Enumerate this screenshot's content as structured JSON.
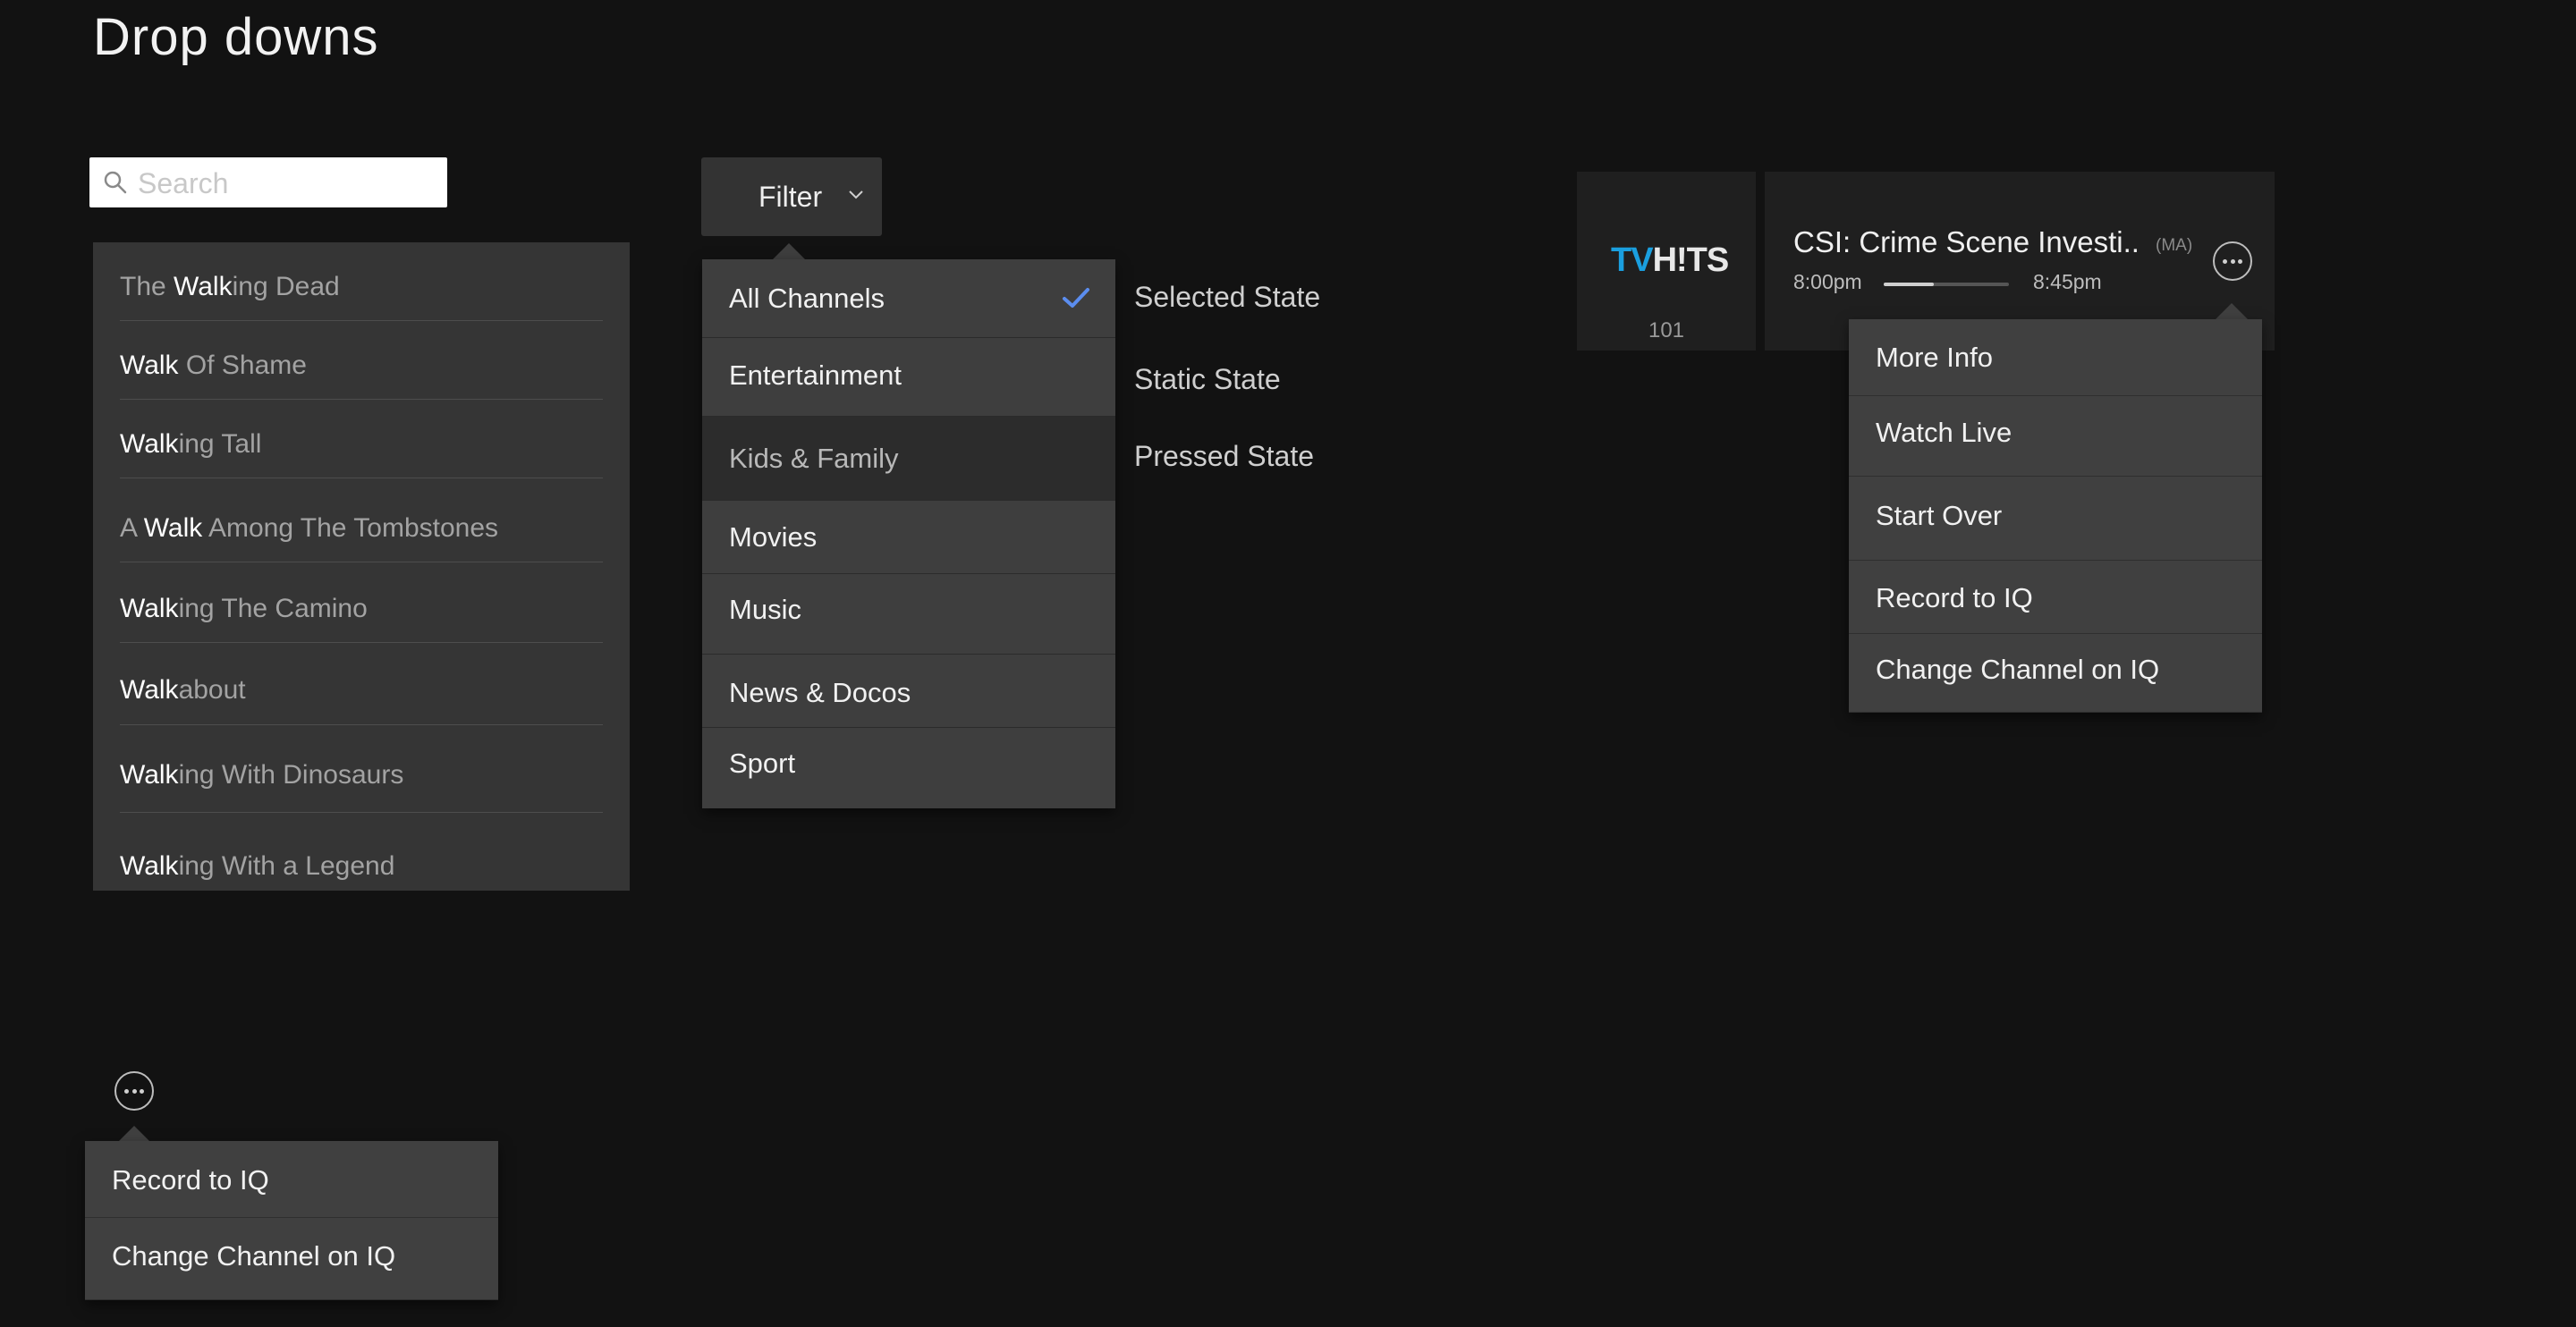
{
  "page": {
    "title": "Drop downs"
  },
  "search": {
    "placeholder": "Search",
    "suggestions": [
      {
        "pre": "The ",
        "match": "Walk",
        "post": "ing Dead"
      },
      {
        "pre": "",
        "match": "Walk",
        "post": " Of Shame"
      },
      {
        "pre": "",
        "match": "Walk",
        "post": "ing Tall"
      },
      {
        "pre": "A ",
        "match": "Walk",
        "post": " Among The Tombstones"
      },
      {
        "pre": "",
        "match": "Walk",
        "post": "ing The Camino"
      },
      {
        "pre": "",
        "match": "Walk",
        "post": "about"
      },
      {
        "pre": "",
        "match": "Walk",
        "post": "ing With Dinosaurs"
      },
      {
        "pre": "",
        "match": "Walk",
        "post": "ing With a Legend"
      }
    ]
  },
  "filter": {
    "label": "Filter",
    "options": [
      "All Channels",
      "Entertainment",
      "Kids & Family",
      "Movies",
      "Music",
      "News & Docos",
      "Sport"
    ],
    "selected": "All Channels",
    "pressed": "Kids & Family"
  },
  "states": {
    "selected": "Selected State",
    "static": "Static State",
    "pressed": "Pressed State"
  },
  "channel": {
    "logo_tv": "TV",
    "logo_hits": "H!TS",
    "number": "101",
    "program_title": "CSI: Crime Scene Investi..",
    "rating": "(MA)",
    "start": "8:00pm",
    "end": "8:45pm",
    "progress": 0.4
  },
  "context_menu": {
    "items": [
      "More Info",
      "Watch Live",
      "Start Over",
      "Record to IQ",
      "Change Channel on IQ"
    ]
  },
  "bottom_menu": {
    "items": [
      "Record to IQ",
      "Change Channel on IQ"
    ]
  },
  "colors": {
    "background": "#121212",
    "panel": "#353535",
    "menu": "#3e3e3e",
    "check": "#5b8def",
    "logo_blue": "#1a9fdf"
  }
}
